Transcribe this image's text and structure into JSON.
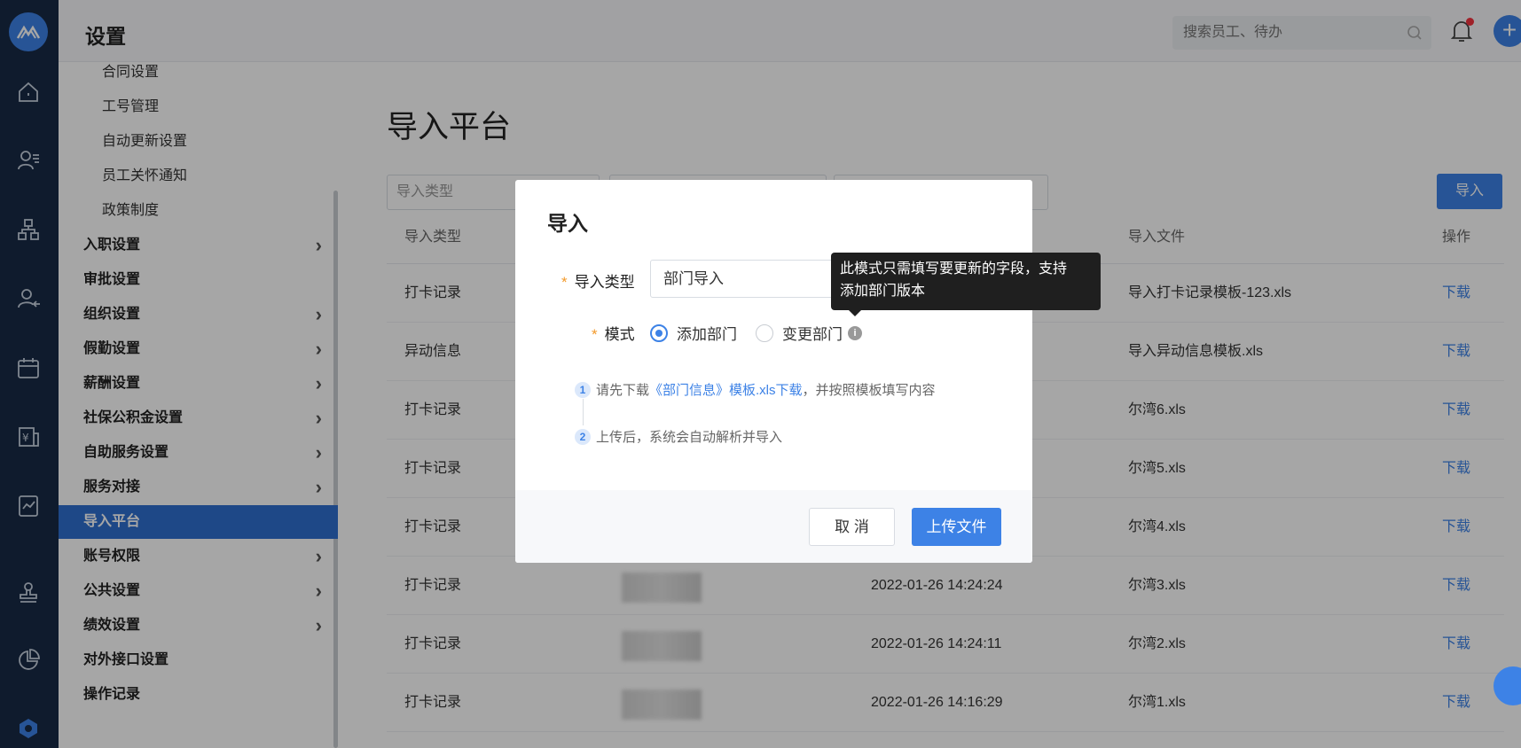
{
  "header": {
    "title": "设置",
    "search_placeholder": "搜索员工、待办"
  },
  "rail": {
    "icons": [
      "logo-icon",
      "home-icon",
      "employee-icon",
      "org-chart-icon",
      "person-leave-icon",
      "calendar-icon",
      "salary-icon",
      "report-icon",
      "stamp-icon",
      "pie-chart-icon",
      "settings-hex-icon"
    ]
  },
  "menu": {
    "items": [
      {
        "label": "合同设置",
        "sub": true,
        "chevron": false
      },
      {
        "label": "工号管理",
        "sub": true,
        "chevron": false
      },
      {
        "label": "自动更新设置",
        "sub": true,
        "chevron": false
      },
      {
        "label": "员工关怀通知",
        "sub": true,
        "chevron": false
      },
      {
        "label": "政策制度",
        "sub": true,
        "chevron": false
      },
      {
        "label": "入职设置",
        "sub": false,
        "chevron": true
      },
      {
        "label": "审批设置",
        "sub": false,
        "chevron": false
      },
      {
        "label": "组织设置",
        "sub": false,
        "chevron": true
      },
      {
        "label": "假勤设置",
        "sub": false,
        "chevron": true
      },
      {
        "label": "薪酬设置",
        "sub": false,
        "chevron": true
      },
      {
        "label": "社保公积金设置",
        "sub": false,
        "chevron": true
      },
      {
        "label": "自助服务设置",
        "sub": false,
        "chevron": true
      },
      {
        "label": "服务对接",
        "sub": false,
        "chevron": true
      },
      {
        "label": "导入平台",
        "sub": false,
        "chevron": false,
        "active": true
      },
      {
        "label": "账号权限",
        "sub": false,
        "chevron": true
      },
      {
        "label": "公共设置",
        "sub": false,
        "chevron": true
      },
      {
        "label": "绩效设置",
        "sub": false,
        "chevron": true
      },
      {
        "label": "对外接口设置",
        "sub": false,
        "chevron": false
      },
      {
        "label": "操作记录",
        "sub": false,
        "chevron": false
      }
    ]
  },
  "main": {
    "title": "导入平台",
    "filter_type_placeholder": "导入类型",
    "import_button": "导入",
    "table": {
      "headers": {
        "type": "导入类型",
        "file": "导入文件",
        "action": "操作"
      },
      "rows": [
        {
          "type": "打卡记录",
          "time": "",
          "file": "导入打卡记录模板-123.xls",
          "action": "下载"
        },
        {
          "type": "异动信息",
          "time": "",
          "file": "导入异动信息模板.xls",
          "action": "下载"
        },
        {
          "type": "打卡记录",
          "time": "",
          "file": "尔湾6.xls",
          "action": "下载"
        },
        {
          "type": "打卡记录",
          "time": "",
          "file": "尔湾5.xls",
          "action": "下载"
        },
        {
          "type": "打卡记录",
          "time": "",
          "file": "尔湾4.xls",
          "action": "下载"
        },
        {
          "type": "打卡记录",
          "time": "2022-01-26 14:24:24",
          "file": "尔湾3.xls",
          "action": "下载"
        },
        {
          "type": "打卡记录",
          "time": "2022-01-26 14:24:11",
          "file": "尔湾2.xls",
          "action": "下载"
        },
        {
          "type": "打卡记录",
          "time": "2022-01-26 14:16:29",
          "file": "尔湾1.xls",
          "action": "下载"
        }
      ]
    }
  },
  "modal": {
    "title": "导入",
    "type_label": "导入类型",
    "type_value": "部门导入",
    "mode_label": "模式",
    "mode_options": [
      {
        "label": "添加部门",
        "selected": true
      },
      {
        "label": "变更部门",
        "selected": false
      }
    ],
    "step1_prefix": "请先下载",
    "step1_link": "《部门信息》模板.xls下载",
    "step1_suffix": "，并按照模板填写内容",
    "step2": "上传后，系统会自动解析并导入",
    "cancel": "取 消",
    "upload": "上传文件"
  },
  "tooltip": {
    "line1": "此模式只需填写要更新的字段，支持",
    "line2": "添加部门版本"
  }
}
